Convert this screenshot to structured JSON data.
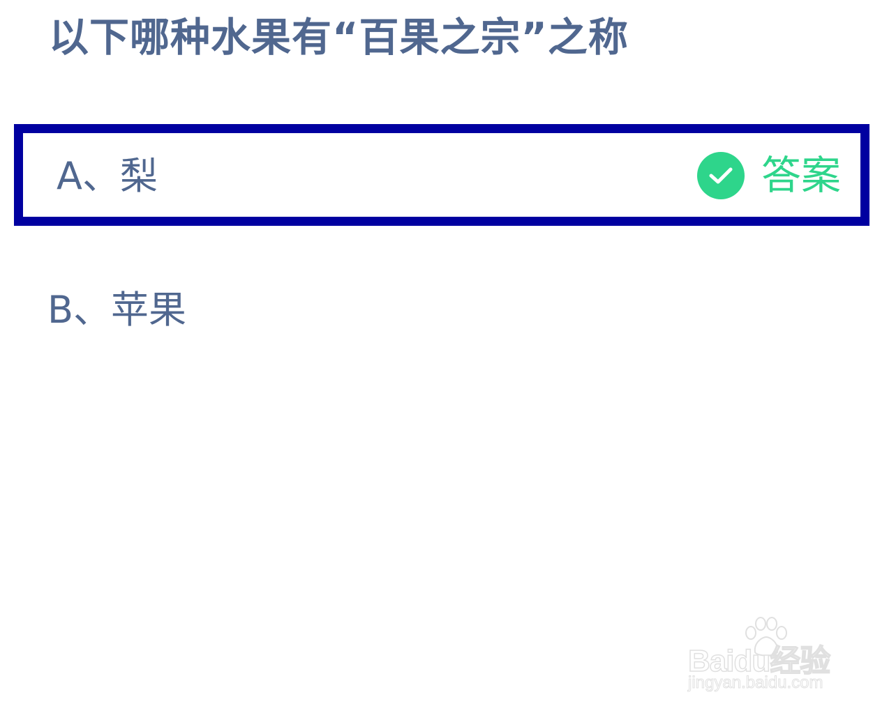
{
  "question": {
    "text": "以下哪种水果有“百果之宗”之称"
  },
  "options": [
    {
      "label": "A、梨",
      "is_answer": true
    },
    {
      "label": "B、苹果",
      "is_answer": false
    }
  ],
  "answer_badge": {
    "text": "答案",
    "icon": "check-circle-icon",
    "color": "#2ed58b"
  },
  "highlight_color": "#0000a0",
  "watermark": {
    "brand": "Baidu经验",
    "url": "jingyan.baidu.com"
  }
}
